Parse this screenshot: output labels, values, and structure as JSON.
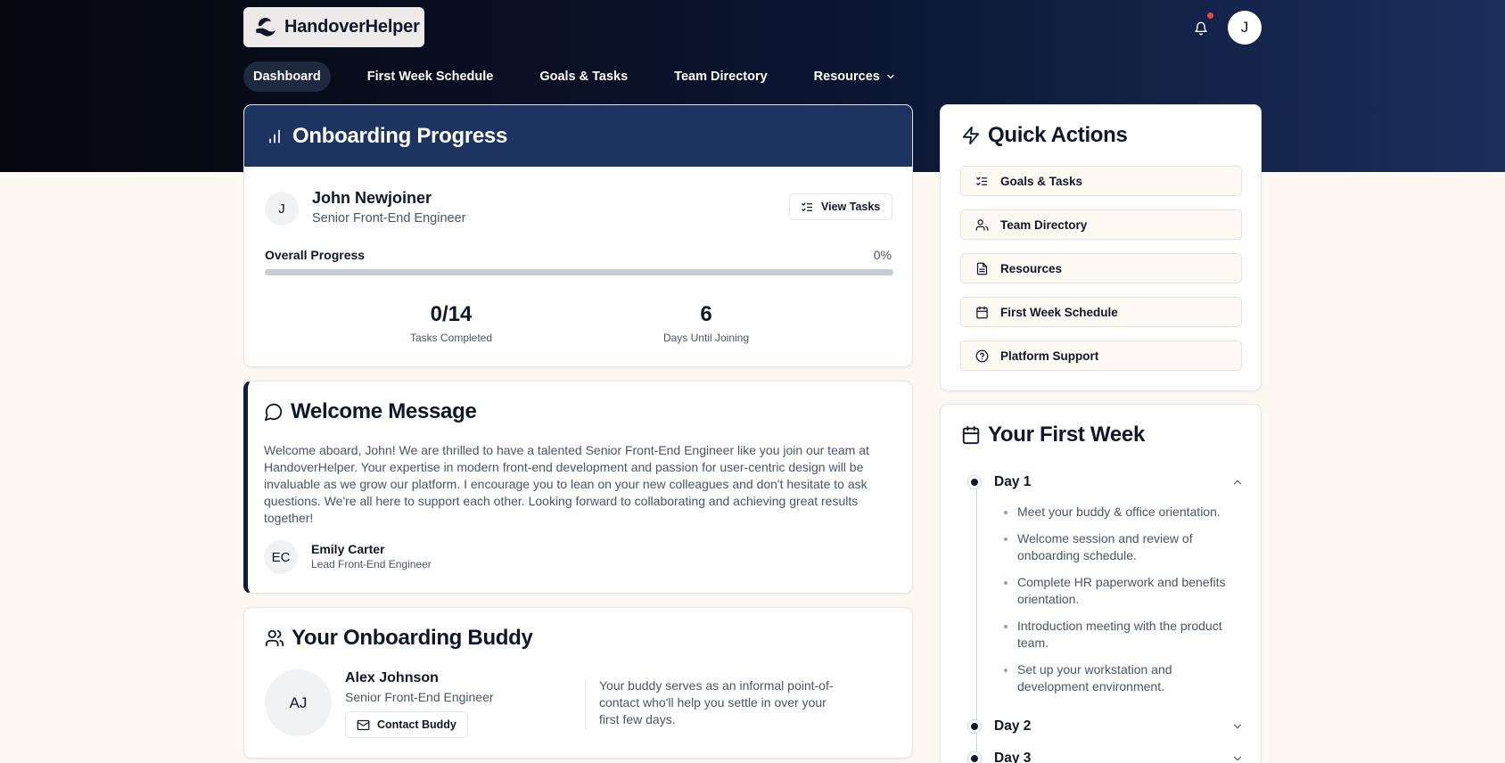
{
  "app": {
    "name": "HandoverHelper",
    "user_initial": "J"
  },
  "nav": {
    "items": [
      {
        "label": "Dashboard",
        "active": true
      },
      {
        "label": "First Week Schedule"
      },
      {
        "label": "Goals & Tasks"
      },
      {
        "label": "Team Directory"
      },
      {
        "label": "Resources",
        "has_dropdown": true
      }
    ]
  },
  "progress": {
    "title": "Onboarding Progress",
    "user": {
      "initial": "J",
      "name": "John Newjoiner",
      "role": "Senior Front-End Engineer"
    },
    "view_tasks_label": "View Tasks",
    "overall_label": "Overall Progress",
    "overall_pct": "0%",
    "overall_value": 0,
    "tasks_completed": "0/14",
    "tasks_completed_label": "Tasks Completed",
    "days_until": "6",
    "days_until_label": "Days Until Joining"
  },
  "welcome": {
    "title": "Welcome Message",
    "body": "Welcome aboard, John! We are thrilled to have a talented Senior Front-End Engineer like you join our team at HandoverHelper. Your expertise in modern front-end development and passion for user-centric design will be invaluable as we grow our platform. I encourage you to lean on your new colleagues and don't hesitate to ask questions. We're all here to support each other. Looking forward to collaborating and achieving great results together!",
    "author": {
      "initials": "EC",
      "name": "Emily Carter",
      "role": "Lead Front-End Engineer"
    }
  },
  "buddy": {
    "title": "Your Onboarding Buddy",
    "initials": "AJ",
    "name": "Alex Johnson",
    "role": "Senior Front-End Engineer",
    "contact_label": "Contact Buddy",
    "note": "Your buddy serves as an informal point-of-contact who'll help you settle in over your first few days."
  },
  "quick_actions": {
    "title": "Quick Actions",
    "items": [
      {
        "label": "Goals & Tasks",
        "icon": "list-checks-icon"
      },
      {
        "label": "Team Directory",
        "icon": "users-icon"
      },
      {
        "label": "Resources",
        "icon": "file-icon"
      },
      {
        "label": "First Week Schedule",
        "icon": "calendar-icon"
      },
      {
        "label": "Platform Support",
        "icon": "help-circle-icon"
      }
    ]
  },
  "first_week": {
    "title": "Your First Week",
    "days": [
      {
        "label": "Day 1",
        "expanded": true,
        "items": [
          "Meet your buddy & office orientation.",
          "Welcome session and review of onboarding schedule.",
          "Complete HR paperwork and benefits orientation.",
          "Introduction meeting with the product team.",
          "Set up your workstation and development environment."
        ]
      },
      {
        "label": "Day 2",
        "expanded": false
      },
      {
        "label": "Day 3",
        "expanded": false
      }
    ]
  },
  "colors": {
    "header_dark": "#05070d",
    "header_navy": "#1d3461",
    "page_bg": "#fdf9f2",
    "notification_dot": "#ef4444"
  }
}
